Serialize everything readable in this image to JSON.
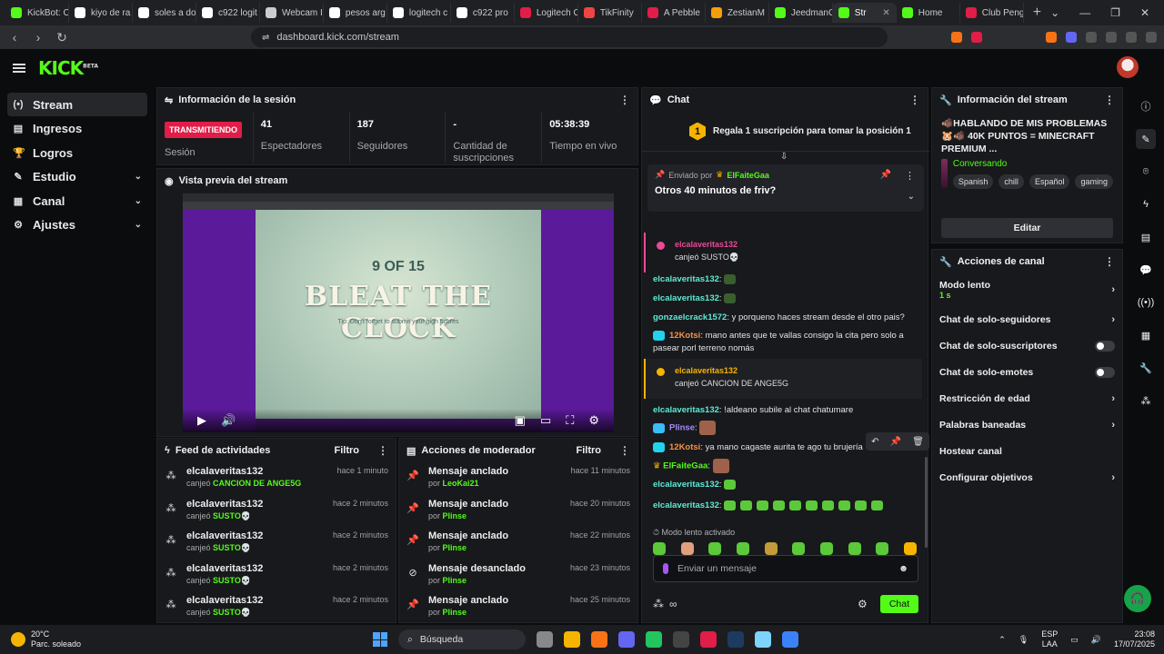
{
  "browser": {
    "tabs": [
      {
        "title": "KickBot: C",
        "color": "#53fc18"
      },
      {
        "title": "kiyo de ra",
        "color": "#ffffff"
      },
      {
        "title": "soles a do",
        "color": "#ffffff"
      },
      {
        "title": "c922 logit",
        "color": "#ffffff"
      },
      {
        "title": "Webcam I",
        "color": "#cccccc"
      },
      {
        "title": "pesos arg",
        "color": "#ffffff"
      },
      {
        "title": "logitech c",
        "color": "#ffffff"
      },
      {
        "title": "c922 pro",
        "color": "#ffffff"
      },
      {
        "title": "Logitech C",
        "color": "#e11d48"
      },
      {
        "title": "TikFinity",
        "color": "#ef4444"
      },
      {
        "title": "A Pebble",
        "color": "#e11d48"
      },
      {
        "title": "ZestianM",
        "color": "#f59e0b"
      },
      {
        "title": "JeedmanG",
        "color": "#53fc18"
      },
      {
        "title": "Str",
        "color": "#53fc18"
      },
      {
        "title": "Home",
        "color": "#53fc18"
      },
      {
        "title": "Club Peng",
        "color": "#e11d48"
      }
    ],
    "url": "dashboard.kick.com/stream"
  },
  "header": {
    "logo": "KICK",
    "logo_sup": "BETA"
  },
  "nav": [
    {
      "label": "Stream",
      "icon": "(•)",
      "chev": ""
    },
    {
      "label": "Ingresos",
      "icon": "▤",
      "chev": ""
    },
    {
      "label": "Logros",
      "icon": "🏆",
      "chev": ""
    },
    {
      "label": "Estudio",
      "icon": "✎",
      "chev": "⌄"
    },
    {
      "label": "Canal",
      "icon": "▦",
      "chev": "⌄"
    },
    {
      "label": "Ajustes",
      "icon": "⚙",
      "chev": "⌄"
    }
  ],
  "session": {
    "title": "Información de la sesión",
    "live_badge": "TRANSMITIENDO",
    "live_label": "Sesión",
    "viewers": "41",
    "viewers_label": "Espectadores",
    "followers": "187",
    "followers_label": "Seguidores",
    "subs": "-",
    "subs_label": "Cantidad de suscripciones",
    "uptime": "05:38:39",
    "uptime_label": "Tiempo en vivo"
  },
  "preview": {
    "title": "Vista previa del stream",
    "game_count": "9 OF 15",
    "game_title": "BLEAT THE CLOCK",
    "game_sub": "Tip: Don't forget to submit your high scores"
  },
  "activity": {
    "title": "Feed de actividades",
    "filter": "Filtro",
    "items": [
      {
        "name": "elcalaveritas132",
        "verb": "canjeó",
        "reward": "CANCION DE ANGE5G",
        "time": "hace 1 minuto"
      },
      {
        "name": "elcalaveritas132",
        "verb": "canjeó",
        "reward": "SUSTO💀",
        "time": "hace 2 minutos"
      },
      {
        "name": "elcalaveritas132",
        "verb": "canjeó",
        "reward": "SUSTO💀",
        "time": "hace 2 minutos"
      },
      {
        "name": "elcalaveritas132",
        "verb": "canjeó",
        "reward": "SUSTO💀",
        "time": "hace 2 minutos"
      },
      {
        "name": "elcalaveritas132",
        "verb": "canjeó",
        "reward": "SUSTO💀",
        "time": "hace 2 minutos"
      }
    ]
  },
  "modactions": {
    "title": "Acciones de moderador",
    "filter": "Filtro",
    "items": [
      {
        "action": "Mensaje anclado",
        "by": "por",
        "user": "LeoKai21",
        "time": "hace 11 minutos"
      },
      {
        "action": "Mensaje anclado",
        "by": "por",
        "user": "Plinse",
        "time": "hace 20 minutos"
      },
      {
        "action": "Mensaje anclado",
        "by": "por",
        "user": "Plinse",
        "time": "hace 22 minutos"
      },
      {
        "action": "Mensaje desanclado",
        "by": "por",
        "user": "Plinse",
        "time": "hace 23 minutos"
      },
      {
        "action": "Mensaje anclado",
        "by": "por",
        "user": "Plinse",
        "time": "hace 25 minutos"
      }
    ]
  },
  "chat": {
    "title": "Chat",
    "gift_num": "1",
    "gift_text": "Regala 1 suscripción para tomar la posición 1",
    "pinned_by_label": "Enviado por",
    "pinned_by": "ElFaiteGaa",
    "pinned_text": "Otros 40 minutos de friv?",
    "redeem1_user": "elcalaveritas132",
    "redeem1_text": "canjeó SUSTO💀",
    "m1_user": "elcalaveritas132",
    "m2_user": "elcalaveritas132",
    "m3_user": "gonzaelcrack1572",
    "m3_text": "y porqueno haces stream desde el otro pais?",
    "m4_user": "12Kotsi",
    "m4_text": "mano antes que te vallas consigo la cita pero solo a pasear porl terreno nomás",
    "redeem2_user": "elcalaveritas132",
    "redeem2_text": "canjeó CANCION DE ANGE5G",
    "m5_user": "elcalaveritas132",
    "m5_text": "!aldeano subile al chat chatumare",
    "m6_user": "Plinse",
    "m7_user": "12Kotsi",
    "m7_text": "ya mano cagaste aurita te ago tu brujería",
    "m8_user": "ElFaiteGaa",
    "m9_user": "elcalaveritas132",
    "m10_user": "elcalaveritas132",
    "slow_note": "Modo lento activado",
    "input_placeholder": "Enviar un mensaje",
    "send": "Chat"
  },
  "streaminfo": {
    "title": "Información del stream",
    "stream_title": "🐗HABLANDO DE MIS PROBLEMAS 🐹🐗 40K PUNTOS = MINECRAFT PREMIUM ...",
    "category": "Conversando",
    "tags": [
      "Spanish",
      "chill",
      "Español",
      "gaming"
    ],
    "edit": "Editar"
  },
  "channel_actions": {
    "title": "Acciones de canal",
    "slow_mode": "Modo lento",
    "slow_value": "1 s",
    "followers_only": "Chat de solo-seguidores",
    "subs_only": "Chat de solo-suscriptores",
    "emotes_only": "Chat de solo-emotes",
    "age": "Restricción de edad",
    "banned": "Palabras baneadas",
    "host": "Hostear canal",
    "goals": "Configurar objetivos"
  },
  "taskbar": {
    "temp": "20°C",
    "weather": "Parc. soleado",
    "search": "Búsqueda",
    "lang1": "ESP",
    "lang2": "LAA",
    "time": "23:08",
    "date": "17/07/2025"
  }
}
